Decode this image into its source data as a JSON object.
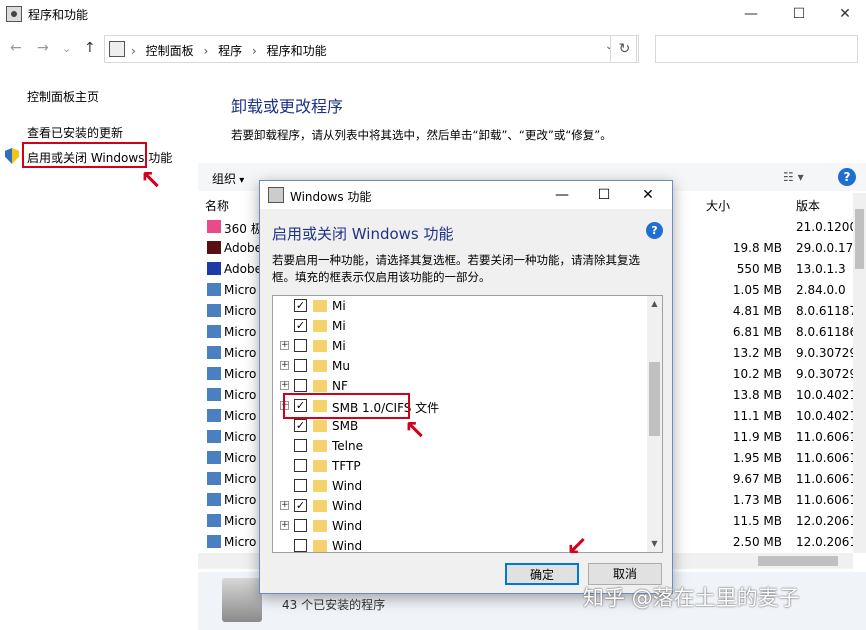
{
  "window": {
    "title": "程序和功能",
    "minimize": "—",
    "maximize": "☐",
    "close": "✕"
  },
  "nav": {
    "back": "←",
    "forward": "→",
    "recent": "⌄",
    "up": "↑",
    "breadcrumb": [
      "控制面板",
      "程序",
      "程序和功能"
    ],
    "separator": "›",
    "dropdown": "⌄",
    "refresh": "↻"
  },
  "sidebar": {
    "items": [
      "控制面板主页",
      "查看已安装的更新",
      "启用或关闭 Windows 功能"
    ]
  },
  "main": {
    "heading": "卸载或更改程序",
    "instruction": "若要卸载程序，请从列表中将其选中，然后单击“卸载”、“更改”或“修复”。",
    "organize": "组织",
    "views_icon": "☷ ▾",
    "help": "?",
    "columns": {
      "name": "名称",
      "size": "大小",
      "version": "版本"
    },
    "rows": [
      {
        "name": "360 极",
        "size": "",
        "version": "21.0.1200",
        "icon": "#e94b8a"
      },
      {
        "name": "Adobe",
        "size": "19.8 MB",
        "version": "29.0.0.171",
        "icon": "#5a1010"
      },
      {
        "name": "Adobe",
        "size": "550 MB",
        "version": "13.0.1.3",
        "icon": "#1c3aa8"
      },
      {
        "name": "Micro",
        "size": "1.05 MB",
        "version": "2.84.0.0",
        "icon": "#4a7fc0"
      },
      {
        "name": "Micro",
        "size": "4.81 MB",
        "version": "8.0.61187",
        "icon": "#4a7fc0"
      },
      {
        "name": "Micro",
        "size": "6.81 MB",
        "version": "8.0.61186",
        "icon": "#4a7fc0"
      },
      {
        "name": "Micro",
        "size": "13.2 MB",
        "version": "9.0.30729",
        "icon": "#4a7fc0"
      },
      {
        "name": "Micro",
        "size": "10.2 MB",
        "version": "9.0.30729",
        "icon": "#4a7fc0"
      },
      {
        "name": "Micro",
        "size": "13.8 MB",
        "version": "10.0.4021",
        "icon": "#4a7fc0"
      },
      {
        "name": "Micro",
        "size": "11.1 MB",
        "version": "10.0.4021",
        "icon": "#4a7fc0"
      },
      {
        "name": "Micro",
        "size": "11.9 MB",
        "version": "11.0.6061",
        "icon": "#4a7fc0"
      },
      {
        "name": "Micro",
        "size": "1.95 MB",
        "version": "11.0.6061",
        "icon": "#4a7fc0"
      },
      {
        "name": "Micro",
        "size": "9.67 MB",
        "version": "11.0.6061",
        "icon": "#4a7fc0"
      },
      {
        "name": "Micro",
        "size": "1.73 MB",
        "version": "11.0.6061",
        "icon": "#4a7fc0"
      },
      {
        "name": "Micro",
        "size": "11.5 MB",
        "version": "12.0.2061",
        "icon": "#4a7fc0"
      },
      {
        "name": "Micro",
        "size": "2.50 MB",
        "version": "12.0.2061",
        "icon": "#4a7fc0"
      }
    ]
  },
  "status": {
    "text": "43 个已安装的程序"
  },
  "watermark": "知乎 @落在土里的麦子",
  "dialog": {
    "title": "Windows 功能",
    "minimize": "—",
    "maximize": "☐",
    "close": "✕",
    "heading": "启用或关闭 Windows 功能",
    "help": "?",
    "description": "若要启用一种功能，请选择其复选框。若要关闭一种功能，请清除其复选框。填充的框表示仅启用该功能的一部分。",
    "features": [
      {
        "label": "Mi",
        "checked": true,
        "expander": false
      },
      {
        "label": "Mi",
        "checked": true,
        "expander": false
      },
      {
        "label": "Mi",
        "checked": false,
        "expander": true
      },
      {
        "label": "Mu",
        "checked": false,
        "expander": true
      },
      {
        "label": "NF",
        "checked": false,
        "expander": true
      },
      {
        "label": "SMB 1.0/CIFS 文件",
        "checked": true,
        "expander": true
      },
      {
        "label": "SMB",
        "checked": true,
        "expander": false
      },
      {
        "label": "Telne",
        "checked": false,
        "expander": false
      },
      {
        "label": "TFTP",
        "checked": false,
        "expander": false
      },
      {
        "label": "Wind",
        "checked": false,
        "expander": false
      },
      {
        "label": "Wind",
        "checked": true,
        "expander": true
      },
      {
        "label": "Wind",
        "checked": false,
        "expander": true
      },
      {
        "label": "Wind",
        "checked": false,
        "expander": false
      }
    ],
    "check_mark": "✓",
    "expand_mark": "+",
    "scroll_up": "▲",
    "scroll_down": "▼",
    "ok": "确定",
    "cancel": "取消"
  },
  "annotations": {
    "arrow": "↖",
    "arrow_ok": "↙",
    "color": "#d0021b"
  }
}
